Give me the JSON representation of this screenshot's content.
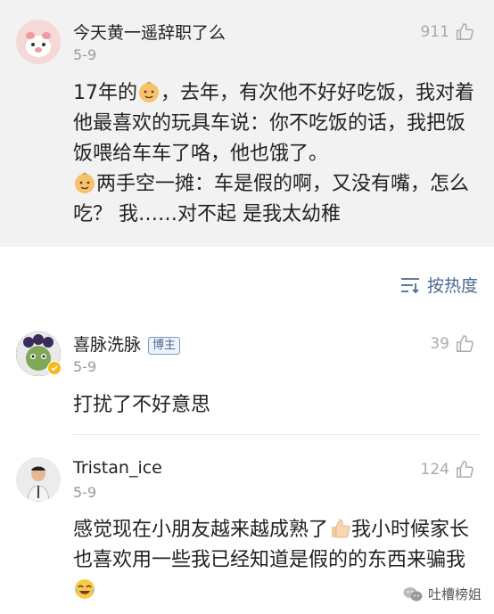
{
  "comments": [
    {
      "username": "今天黄一遥辞职了么",
      "date": "5-9",
      "likes": "911",
      "text_parts": [
        "17年的",
        "，去年，有次他不好好吃饭，我对着他最喜欢的玩具车说：你不吃饭的话，我把饭饭喂给车车了咯，他也饿了。",
        "两手空一摊：车是假的啊，又没有嘴，怎么吃？ 我……对不起 是我太幼稚"
      ],
      "emoji": "baby-emoji"
    },
    {
      "username": "喜脉洗脉",
      "badge": "博主",
      "date": "5-9",
      "likes": "39",
      "text": "打扰了不好意思"
    },
    {
      "username": "Tristan_ice",
      "date": "5-9",
      "likes": "124",
      "text_parts": [
        "感觉现在小朋友越来越成熟了",
        "我小时候家长也喜欢用一些我已经知道是假的的东西来骗我"
      ],
      "emoji": [
        "thumbs-up-emoji",
        "tears-of-joy-emoji"
      ]
    }
  ],
  "sort": {
    "label": "按热度"
  },
  "watermark": {
    "label": "吐槽榜姐"
  },
  "colors": {
    "accent": "#4a6a8f",
    "muted": "#999999",
    "card_bg": "#f2f2f2"
  }
}
